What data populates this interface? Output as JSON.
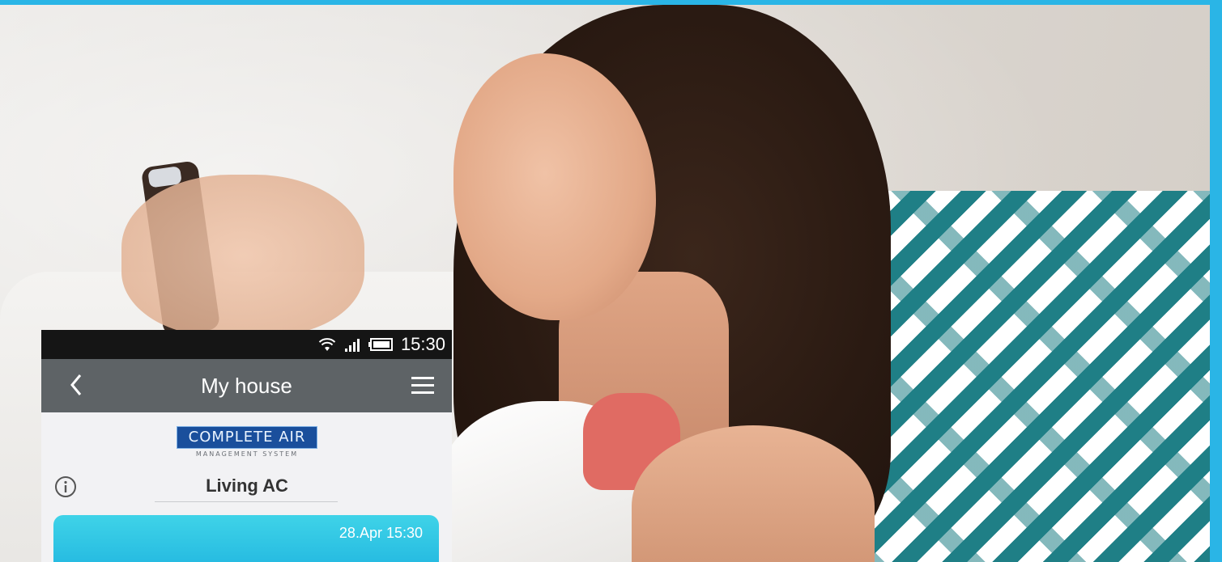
{
  "status_bar": {
    "time": "15:30",
    "icons": [
      "wifi-icon",
      "signal-icon",
      "battery-icon"
    ]
  },
  "nav": {
    "title": "My house",
    "back_icon": "chevron-left-icon",
    "menu_icon": "hamburger-menu-icon"
  },
  "logo": {
    "main": "COMPLETE AIR",
    "sub": "MANAGEMENT SYSTEM"
  },
  "device": {
    "info_icon": "info-icon",
    "name": "Living AC"
  },
  "card": {
    "timestamp": "28.Apr 15:30"
  },
  "colors": {
    "frame": "#2ab5e6",
    "nav_bar": "#5e6366",
    "status_bar": "#151515",
    "card": "#22b7e0",
    "pillow_teal": "#1f7f86"
  }
}
